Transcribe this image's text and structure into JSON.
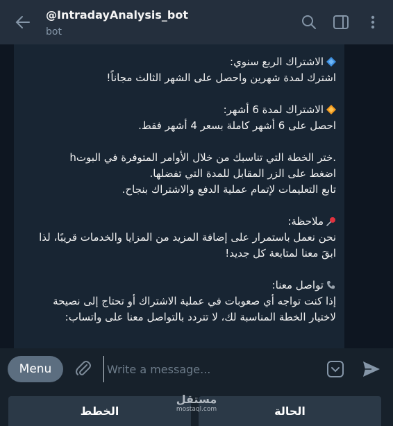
{
  "header": {
    "title": "@IntradayAnalysis_bot",
    "subtitle": "bot",
    "icons": [
      "back-arrow-icon",
      "search-icon",
      "sidebar-toggle-icon",
      "more-vertical-icon"
    ]
  },
  "message": {
    "lines": [
      "الاشتراك الربع سنوي:",
      "اشترك لمدة شهرين واحصل على الشهر الثالث مجاناً!",
      "",
      "الاشتراك لمدة 6 أشهر:",
      "احصل على 6 أشهر كاملة بسعر 4 أشهر فقط.",
      "",
      ".ختر الخطة التي تناسبك من خلال الأوامر المتوفرة في البوتh",
      "اضغط على الزر المقابل للمدة التي تفضلها.",
      "تابع التعليمات لإتمام عملية الدفع والاشتراك بنجاح.",
      "",
      "ملاحظة:",
      "نحن نعمل باستمرار على إضافة المزيد من المزايا والخدمات قريبًا، لذا",
      "ابقَ معنا لمتابعة كل جديد!",
      "",
      "تواصل معنا:",
      "إذا كنت تواجه أي صعوبات في عملية الاشتراك أو تحتاج إلى نصيحة",
      "لاختيار الخطة المناسبة لك، لا تتردد بالتواصل معنا على واتساب:",
      ""
    ],
    "emoji_icons": [
      "blue-diamond-icon",
      "orange-diamond-icon",
      "pushpin-icon",
      "telephone-icon"
    ]
  },
  "composer": {
    "menu_label": "Menu",
    "placeholder": "Write a message..."
  },
  "keyboard": {
    "left_button": "الخطط",
    "right_button": "الحالة"
  },
  "watermark": {
    "text": "مستقل",
    "domain": "mostaql.com"
  },
  "colors": {
    "background": "#0e1621",
    "header": "#242f3d",
    "bubble": "#182533",
    "menu_button": "#5c6e80",
    "keyboard_button": "#2b3947",
    "accent": "#5eb5f7"
  }
}
